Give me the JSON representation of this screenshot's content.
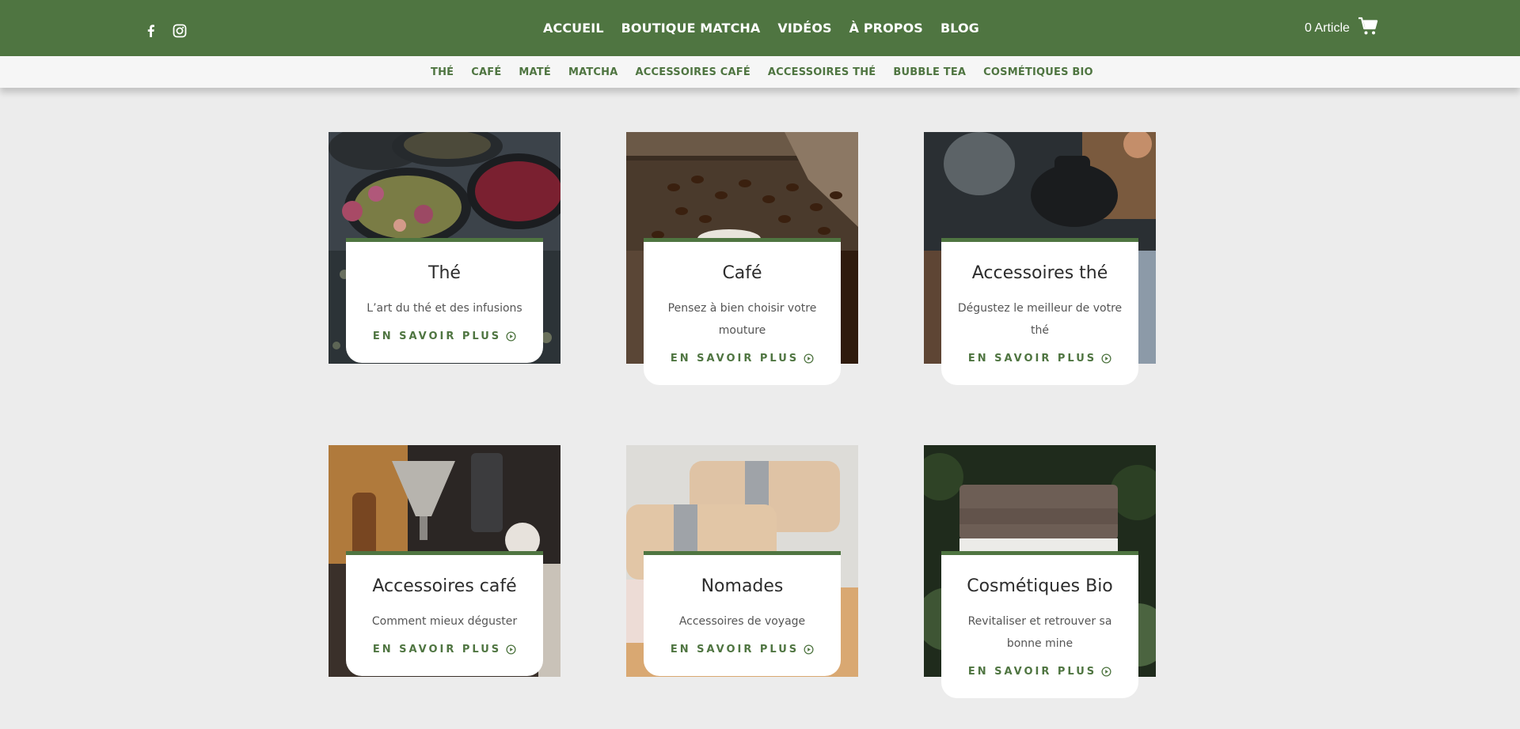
{
  "header": {
    "social": [
      {
        "icon": "facebook-icon"
      },
      {
        "icon": "instagram-icon"
      }
    ],
    "nav": [
      "ACCUEIL",
      "BOUTIQUE MATCHA",
      "VIDÉOS",
      "À PROPOS",
      "BLOG"
    ],
    "cart_label": "0 Article",
    "cart_icon": "cart-icon"
  },
  "subnav": [
    "THÉ",
    "CAFÉ",
    "MATÉ",
    "MATCHA",
    "ACCESSOIRES CAFÉ",
    "ACCESSOIRES THÉ",
    "BUBBLE TEA",
    "COSMÉTIQUES BIO"
  ],
  "cards": [
    {
      "title": "Thé",
      "text": "L’art du thé et des infusions",
      "link": "EN SAVOIR PLUS"
    },
    {
      "title": "Café",
      "text": "Pensez à bien choisir votre mouture",
      "link": "EN SAVOIR PLUS"
    },
    {
      "title": "Accessoires thé",
      "text": "Dégustez le meilleur de votre thé",
      "link": "EN SAVOIR PLUS"
    },
    {
      "title": "Accessoires café",
      "text": "Comment mieux déguster",
      "link": "EN SAVOIR PLUS"
    },
    {
      "title": "Nomades",
      "text": "Accessoires de voyage",
      "link": "EN SAVOIR PLUS"
    },
    {
      "title": "Cosmétiques Bio",
      "text": "Revitaliser et retrouver sa bonne mine",
      "link": "EN SAVOIR PLUS"
    }
  ],
  "colors": {
    "brand": "#4f7541",
    "background": "#ececec"
  }
}
